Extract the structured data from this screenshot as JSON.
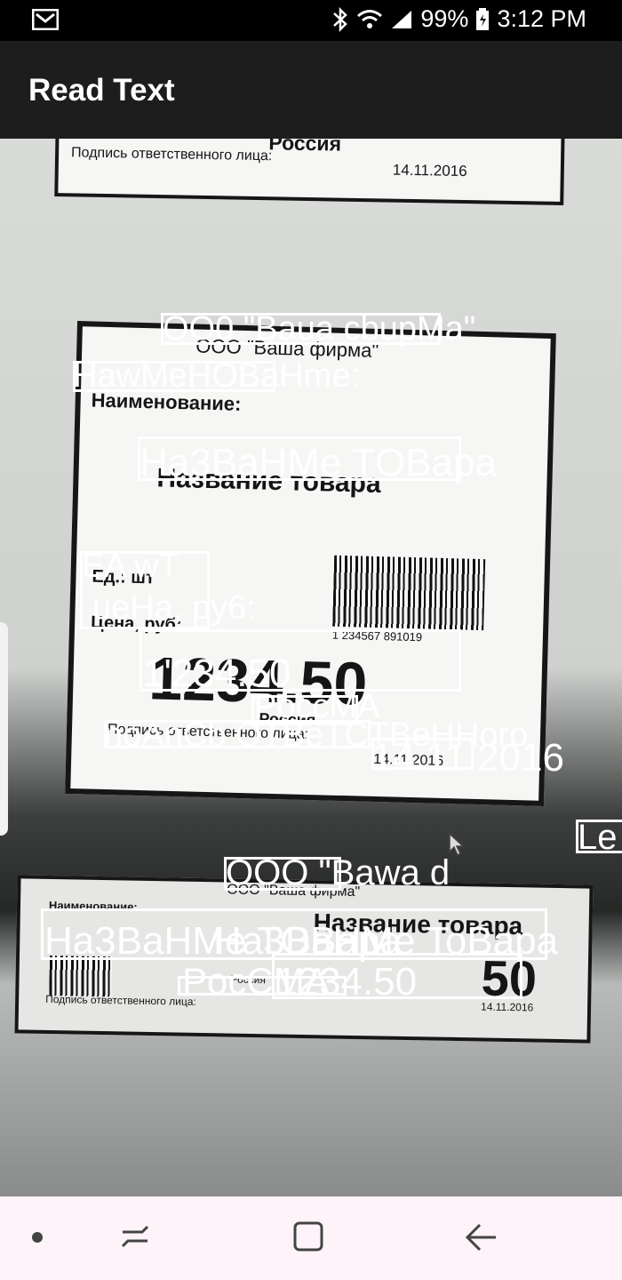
{
  "status_bar": {
    "battery_percent": "99%",
    "time": "3:12 PM",
    "icons": [
      "gmail-icon",
      "bluetooth-icon",
      "wifi-icon",
      "signal-icon",
      "battery-icon"
    ]
  },
  "app_bar": {
    "title": "Read Text"
  },
  "camera_scene": {
    "label_top": {
      "country": "Россия",
      "signature": "Подпись ответственного лица:",
      "date": "14.11.2016"
    },
    "label_main": {
      "company": "ООО \"Ваша фирма\"",
      "name_header": "Наименование:",
      "product": "Название товара",
      "unit": "Ед.: шт",
      "price_label": "Цена, руб:",
      "price": "1234.50",
      "barcode_digits": "1 234567 891019",
      "country": "Россия",
      "signature": "Подпись ответственного лица:",
      "date": "14.11.2016"
    },
    "label_bottom": {
      "company": "ООО \"Ваша фирма\"",
      "name_header": "Наименование:",
      "product": "Название товара",
      "price": "50",
      "country": "Россия",
      "signature": "Подпись ответственного лица:",
      "date": "14.11.2016"
    }
  },
  "ocr_results": [
    {
      "text": "OO0 \"Baua cbupMa\""
    },
    {
      "text": "HawMeHOBaHme:"
    },
    {
      "text": "Ha3BaHMe TOBapa"
    },
    {
      "text": "EA wT"
    },
    {
      "text": "ueHa, py6:"
    },
    {
      "text": "1'234.50"
    },
    {
      "text": "PoccMA"
    },
    {
      "text": "noAnCb OTBeTCTBeHHoro"
    },
    {
      "text": "14.11.2016"
    },
    {
      "text": "Le"
    },
    {
      "text": "OOO \"Bawa d"
    },
    {
      "text": "Ha3BaHMe TOBapa"
    },
    {
      "text": "Ha3BaHMe ToBapa"
    },
    {
      "text": "PocCMA"
    },
    {
      "text": "1234.50"
    }
  ],
  "nav_bar": {
    "buttons": [
      "dot-icon",
      "recents-icon",
      "home-icon",
      "back-icon"
    ]
  },
  "colors": {
    "status_bar": "#000000",
    "app_bar": "#1d1d1d",
    "nav_bar": "#fdf3f8",
    "overlay": "#ffffff"
  }
}
